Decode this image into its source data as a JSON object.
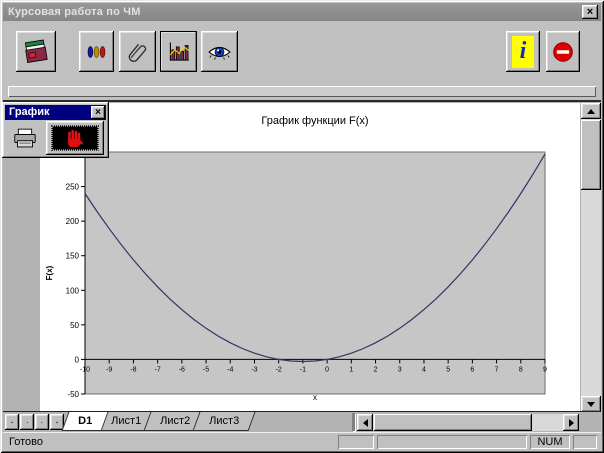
{
  "window": {
    "title": "Курсовая работа по ЧМ",
    "close_glyph": "×"
  },
  "toolbar": {
    "buttons": [
      {
        "icon": "books-icon"
      },
      {
        "icon": "ellipses-icon"
      },
      {
        "icon": "paperclip-icon"
      },
      {
        "icon": "bar-chart-icon",
        "active": true
      },
      {
        "icon": "eye-icon"
      }
    ],
    "right_buttons": [
      {
        "icon": "info-icon",
        "glyph": "i"
      },
      {
        "icon": "stop-icon"
      }
    ]
  },
  "palette": {
    "title": "График",
    "close_glyph": "×",
    "buttons": [
      {
        "icon": "printer-icon"
      },
      {
        "icon": "hand-icon",
        "active": true
      }
    ]
  },
  "chart_data": {
    "type": "line",
    "title": "График функции F(x)",
    "xlabel": "x",
    "ylabel": "F(x)",
    "xlim": [
      -10,
      9
    ],
    "ylim": [
      -50,
      300
    ],
    "x_ticks": [
      -10,
      -9,
      -8,
      -7,
      -6,
      -5,
      -4,
      -3,
      -2,
      -1,
      0,
      1,
      2,
      3,
      4,
      5,
      6,
      7,
      8,
      9
    ],
    "y_ticks": [
      -50,
      0,
      50,
      100,
      150,
      200,
      250
    ],
    "grid": false,
    "plot_bg": "#c6c6c6",
    "series": [
      {
        "name": "F(x)",
        "color": "#333366",
        "points": [
          [
            -10,
            240
          ],
          [
            -9.5,
            213.75
          ],
          [
            -9,
            189
          ],
          [
            -8.5,
            165.75
          ],
          [
            -8,
            144
          ],
          [
            -7.5,
            123.75
          ],
          [
            -7,
            105
          ],
          [
            -6.5,
            87.75
          ],
          [
            -6,
            72
          ],
          [
            -5.5,
            57.75
          ],
          [
            -5,
            45
          ],
          [
            -4.5,
            33.75
          ],
          [
            -4,
            24
          ],
          [
            -3.5,
            15.75
          ],
          [
            -3,
            9
          ],
          [
            -2.5,
            3.75
          ],
          [
            -2,
            0
          ],
          [
            -1.5,
            -2.25
          ],
          [
            -1,
            -3
          ],
          [
            -0.5,
            -2.25
          ],
          [
            0,
            0
          ],
          [
            0.5,
            3.75
          ],
          [
            1,
            9
          ],
          [
            1.5,
            15.75
          ],
          [
            2,
            24
          ],
          [
            2.5,
            33.75
          ],
          [
            3,
            45
          ],
          [
            3.5,
            57.75
          ],
          [
            4,
            72
          ],
          [
            4.5,
            87.75
          ],
          [
            5,
            105
          ],
          [
            5.5,
            123.75
          ],
          [
            6,
            144
          ],
          [
            6.5,
            165.75
          ],
          [
            7,
            189
          ],
          [
            7.5,
            213.75
          ],
          [
            8,
            240
          ],
          [
            8.5,
            267.75
          ],
          [
            9,
            297
          ]
        ]
      }
    ]
  },
  "tabs": {
    "items": [
      {
        "label": "D1",
        "active": true
      },
      {
        "label": "Лист1",
        "active": false
      },
      {
        "label": "Лист2",
        "active": false
      },
      {
        "label": "Лист3",
        "active": false
      }
    ]
  },
  "status_bar": {
    "message": "Готово",
    "panes": [
      "",
      "",
      "NUM",
      ""
    ]
  },
  "colors": {
    "palette_titlebar": "#000080",
    "inactive_titlebar": "#8e8e8e",
    "curve": "#333366"
  }
}
